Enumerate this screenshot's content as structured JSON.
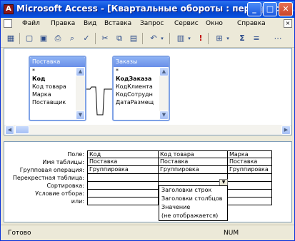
{
  "window": {
    "title": "Microsoft Access - [Квартальные обороты : перекрестн...",
    "minimize_glyph": "_",
    "maximize_glyph": "□",
    "close_glyph": "✕",
    "app_icon_glyph": "A"
  },
  "menu": {
    "items": [
      {
        "label": "Файл"
      },
      {
        "label": "Правка"
      },
      {
        "label": "Вид"
      },
      {
        "label": "Вставка"
      },
      {
        "label": "Запрос"
      },
      {
        "label": "Сервис"
      },
      {
        "label": "Окно"
      },
      {
        "label": "Справка"
      }
    ],
    "close_glyph": "×"
  },
  "toolbar": {
    "icons": [
      "design-view-icon",
      "new-icon",
      "save-icon",
      "print-icon",
      "print-preview-icon",
      "spelling-icon",
      "cut-icon",
      "copy-icon",
      "paste-icon",
      "undo-icon",
      "query-type-icon",
      "run-icon",
      "show-table-icon",
      "totals-icon"
    ]
  },
  "tables": [
    {
      "name": "Поставка",
      "fields": [
        {
          "label": "*",
          "bold": false
        },
        {
          "label": "Код",
          "bold": true
        },
        {
          "label": "Код товара",
          "bold": false
        },
        {
          "label": "Марка",
          "bold": false
        },
        {
          "label": "Поставщик",
          "bold": false
        }
      ]
    },
    {
      "name": "Заказы",
      "fields": [
        {
          "label": "*",
          "bold": false
        },
        {
          "label": "КодЗаказа",
          "bold": true
        },
        {
          "label": "КодКлиента",
          "bold": false
        },
        {
          "label": "КодСотрудн",
          "bold": false
        },
        {
          "label": "ДатаРазмещ",
          "bold": false
        }
      ]
    }
  ],
  "grid": {
    "row_labels": [
      "Поле:",
      "Имя таблицы:",
      "Групповая операция:",
      "Перекрестная таблица:",
      "Сортировка:",
      "Условие отбора:",
      "или:"
    ],
    "columns": [
      {
        "cells": [
          "Код",
          "Поставка",
          "Группировка",
          "",
          "",
          "",
          ""
        ]
      },
      {
        "cells": [
          "Код товара",
          "Поставка",
          "Группировка",
          "",
          "",
          "",
          ""
        ]
      },
      {
        "cells": [
          "Марка",
          "Поставка",
          "Группировка",
          "",
          "",
          "",
          ""
        ]
      }
    ],
    "dropdown_options": [
      "Заголовки строк",
      "Заголовки столбцов",
      "Значение",
      "(не отображается)"
    ]
  },
  "status": {
    "text": "Готово",
    "indicator": "NUM"
  }
}
